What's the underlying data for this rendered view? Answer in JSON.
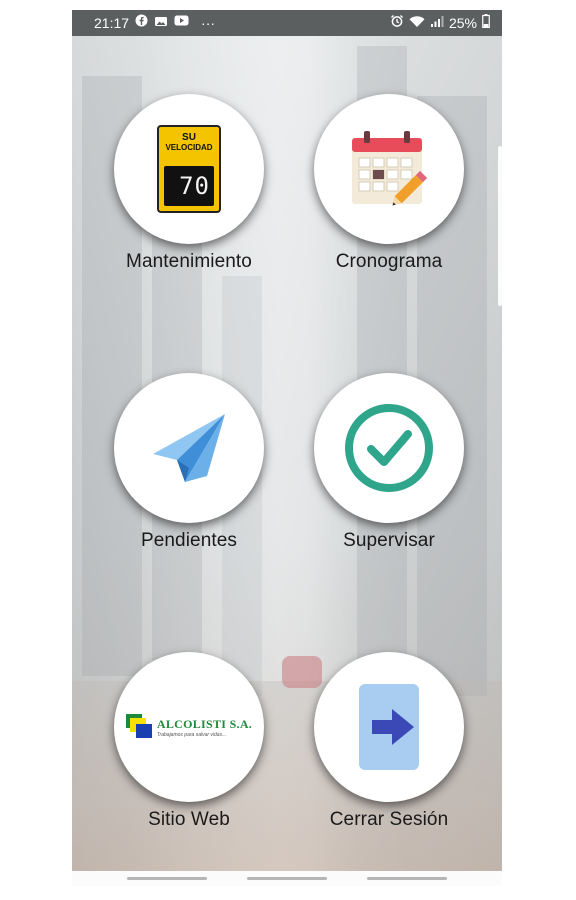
{
  "status_bar": {
    "time": "21:17",
    "more": "···",
    "battery": "25%"
  },
  "menu": {
    "items": [
      {
        "id": "mantenimiento",
        "label": "Mantenimiento",
        "icon": "speed-sign-icon",
        "sign_line1": "SU",
        "sign_line2": "VELOCIDAD",
        "sign_value": "70"
      },
      {
        "id": "cronograma",
        "label": "Cronograma",
        "icon": "calendar-pencil-icon"
      },
      {
        "id": "pendientes",
        "label": "Pendientes",
        "icon": "paper-plane-icon"
      },
      {
        "id": "supervisar",
        "label": "Supervisar",
        "icon": "check-circle-icon"
      },
      {
        "id": "sitio-web",
        "label": "Sitio Web",
        "icon": "company-logo",
        "logo_name": "ALCOLISTI S.A.",
        "logo_tagline": "Trabajamos para salvar vidas..."
      },
      {
        "id": "cerrar-sesion",
        "label": "Cerrar Sesión",
        "icon": "logout-arrow-icon"
      }
    ]
  },
  "colors": {
    "sign_yellow": "#f5c400",
    "calendar_red": "#e84c5b",
    "plane_blue": "#4a9be0",
    "check_teal": "#2fa58c",
    "logout_bg": "#a9cdf0",
    "logout_arrow": "#3a49b5",
    "logo_green": "#1f8a3a"
  }
}
